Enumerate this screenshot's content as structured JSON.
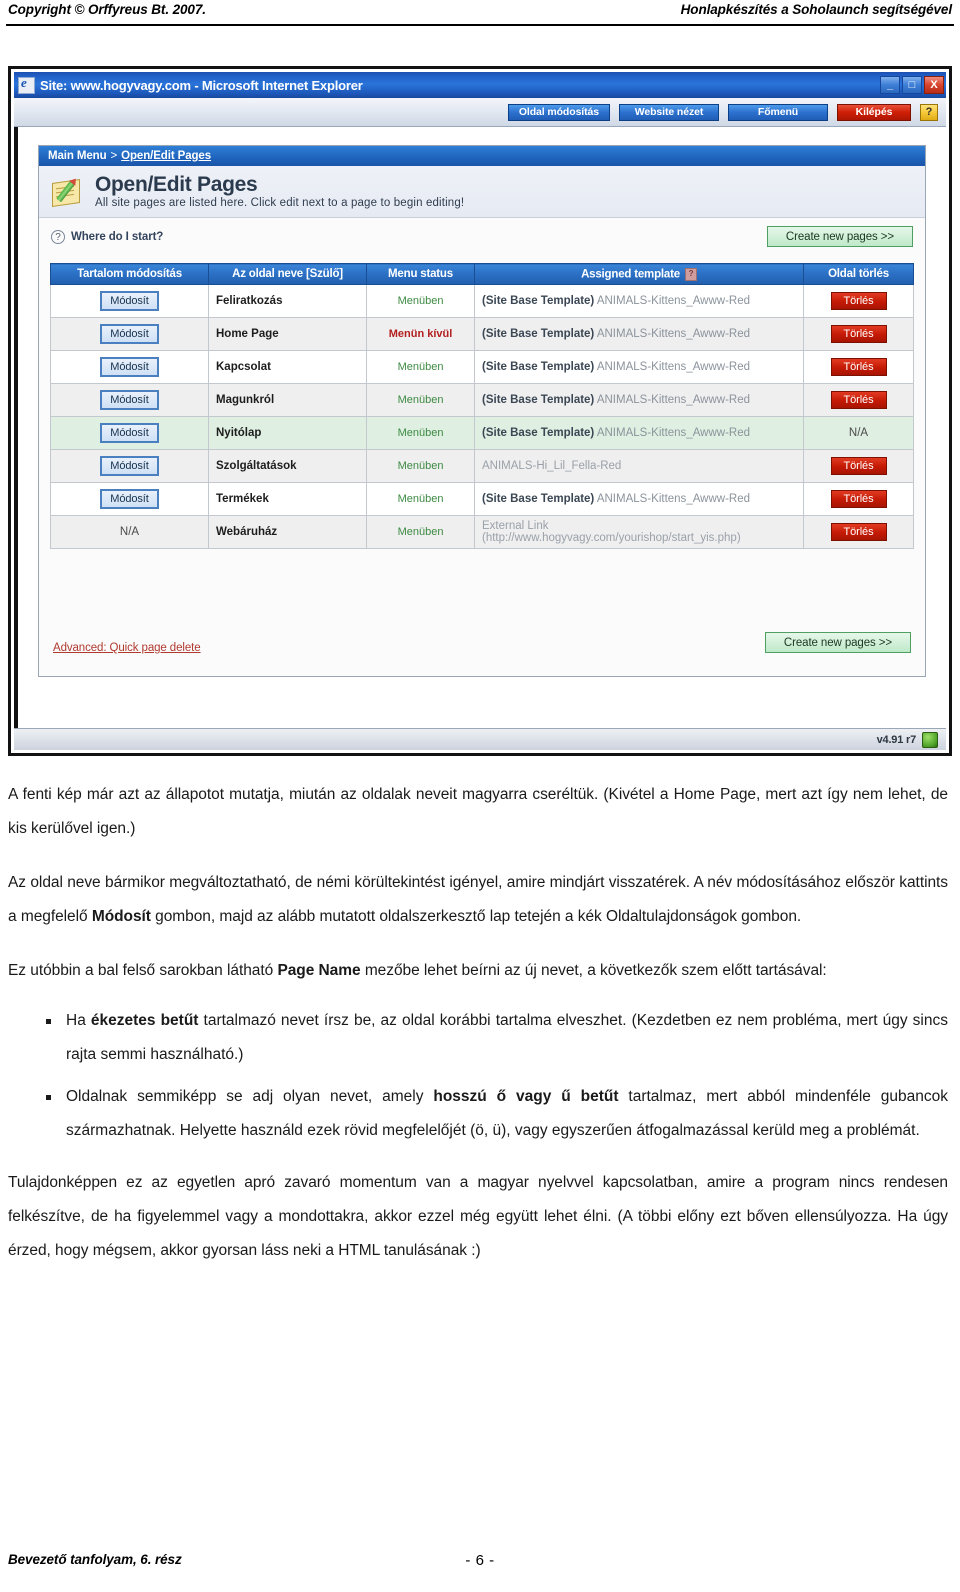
{
  "document_header": {
    "left": "Copyright © Orffyreus Bt. 2007.",
    "right": "Honlapkészítés a Soholaunch segítségével"
  },
  "document_footer": {
    "left": "Bevezető tanfolyam, 6. rész",
    "page_number": "- 6 -"
  },
  "screenshot": {
    "window": {
      "title": "Site: www.hogyvagy.com - Microsoft Internet Explorer",
      "minimize_label": "_",
      "maximize_label": "□",
      "close_label": "X"
    },
    "toolbar": {
      "buttons": [
        {
          "label": "Oldal módosítás",
          "style": "blue"
        },
        {
          "label": "Website nézet",
          "style": "blue"
        },
        {
          "label": "Főmenü",
          "style": "blue"
        },
        {
          "label": "Kilépés",
          "style": "red"
        }
      ],
      "help_label": "?"
    },
    "breadcrumb": {
      "root": "Main Menu",
      "separator": ">",
      "current": "Open/Edit Pages"
    },
    "page": {
      "title": "Open/Edit Pages",
      "subtitle": "All site pages are listed here. Click edit next to a page to begin editing!",
      "help_link": "Where do I start?",
      "help_icon_label": "?",
      "create_pages_label": "Create new pages >>",
      "advanced_link": "Advanced: Quick page delete"
    },
    "table": {
      "headers": {
        "edit": "Tartalom módosítás",
        "name": "Az oldal neve [Szülő]",
        "status": "Menu status",
        "template": "Assigned template",
        "template_icon": "?",
        "delete": "Oldal törlés"
      },
      "edit_button_label": "Módosít",
      "delete_button_label": "Törlés",
      "na_label": "N/A",
      "rows": [
        {
          "edit": "Módosít",
          "name": "Feliratkozás",
          "status": "Menüben",
          "status_type": "in",
          "template_strong": "(Site Base Template)",
          "template_rest": " ANIMALS-Kittens_Awww-Red",
          "delete": "Törlés",
          "row_style": "norm"
        },
        {
          "edit": "Módosít",
          "name": "Home Page",
          "status": "Menün kívül",
          "status_type": "out",
          "template_strong": "(Site Base Template)",
          "template_rest": " ANIMALS-Kittens_Awww-Red",
          "delete": "Törlés",
          "row_style": "alt"
        },
        {
          "edit": "Módosít",
          "name": "Kapcsolat",
          "status": "Menüben",
          "status_type": "in",
          "template_strong": "(Site Base Template)",
          "template_rest": " ANIMALS-Kittens_Awww-Red",
          "delete": "Törlés",
          "row_style": "norm"
        },
        {
          "edit": "Módosít",
          "name": "Magunkról",
          "status": "Menüben",
          "status_type": "in",
          "template_strong": "(Site Base Template)",
          "template_rest": " ANIMALS-Kittens_Awww-Red",
          "delete": "Törlés",
          "row_style": "alt"
        },
        {
          "edit": "Módosít",
          "name": "Nyitólap",
          "status": "Menüben",
          "status_type": "in",
          "template_strong": "(Site Base Template)",
          "template_rest": " ANIMALS-Kittens_Awww-Red",
          "delete": "N/A",
          "row_style": "cur"
        },
        {
          "edit": "Módosít",
          "name": "Szolgáltatások",
          "status": "Menüben",
          "status_type": "in",
          "template_strong": "",
          "template_rest": "ANIMALS-Hi_Lil_Fella-Red",
          "delete": "Törlés",
          "row_style": "alt"
        },
        {
          "edit": "Módosít",
          "name": "Termékek",
          "status": "Menüben",
          "status_type": "in",
          "template_strong": "(Site Base Template)",
          "template_rest": " ANIMALS-Kittens_Awww-Red",
          "delete": "Törlés",
          "row_style": "norm"
        },
        {
          "edit": "N/A",
          "name": "Webáruház",
          "status": "Menüben",
          "status_type": "in",
          "template_strong": "",
          "template_rest": "External Link (http://www.hogyvagy.com/yourishop/start_yis.php)",
          "delete": "Törlés",
          "row_style": "alt"
        }
      ]
    },
    "statusbar": {
      "version": "v4.91 r7"
    }
  },
  "body_text": {
    "p1_a": "A fenti kép már azt az állapotot mutatja, miután az oldalak neveit magyarra cseréltük. (Kivétel a Home Page, mert azt így nem lehet, de kis kerülővel igen.)",
    "p2_a": "Az oldal neve bármikor megváltoztatható, de némi körültekintést igényel, amire mindjárt visszatérek. A név módosításához először kattints a megfelelő ",
    "p2_bold": "Módosít",
    "p2_b": " gombon, majd az alább mutatott oldalszerkesztő lap tetején a kék Oldaltulajdonságok gombon.",
    "p3_a": "Ez utóbbin a bal felső sarokban látható ",
    "p3_bold": "Page Name",
    "p3_b": " mezőbe lehet beírni az új nevet, a következők szem előtt tartásával:",
    "b1_a": "Ha ",
    "b1_bold": "ékezetes betűt",
    "b1_b": " tartalmazó nevet írsz be, az oldal korábbi tartalma elveszhet. (Kezdetben ez nem probléma, mert úgy sincs rajta semmi használható.)",
    "b2_a": "Oldalnak semmiképp se adj olyan nevet, amely ",
    "b2_bold": "hosszú ő vagy ű betűt",
    "b2_b": " tartalmaz, mert abból mindenféle gubancok származhatnak. Helyette használd ezek rövid megfelelőjét (ö, ü), vagy egyszerűen átfogalmazással kerüld meg a problémát.",
    "p4_a": "Tulajdonképpen ez az egyetlen apró zavaró momentum van a magyar nyelvvel kapcsolatban, amire a program nincs rendesen felkészítve, de ha figyelemmel vagy a mondottakra, akkor ezzel még együtt lehet élni. (A többi előny ezt bőven ellensúlyozza. Ha úgy érzed, hogy mégsem, akkor gyorsan láss neki a HTML tanulásának :)"
  }
}
